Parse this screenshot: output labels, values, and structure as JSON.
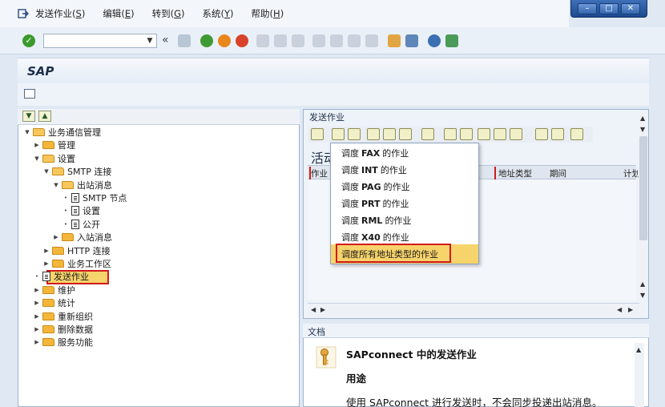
{
  "menu": {
    "items": [
      {
        "label": "发送作业",
        "key": "S"
      },
      {
        "label": "编辑",
        "key": "E"
      },
      {
        "label": "转到",
        "key": "G"
      },
      {
        "label": "系统",
        "key": "Y"
      },
      {
        "label": "帮助",
        "key": "H"
      }
    ]
  },
  "window_controls": {
    "minimize": "–",
    "maximize": "□",
    "close": "✕"
  },
  "toolbar": {
    "command_field_value": "",
    "nav_back": "«"
  },
  "title": "SAP",
  "tree": {
    "nodes": [
      {
        "label": "业务通信管理",
        "level": 0,
        "expanded": true,
        "type": "folder"
      },
      {
        "label": "管理",
        "level": 1,
        "expanded": false,
        "type": "folder"
      },
      {
        "label": "设置",
        "level": 1,
        "expanded": true,
        "type": "folder"
      },
      {
        "label": "SMTP 连接",
        "level": 2,
        "expanded": true,
        "type": "folder"
      },
      {
        "label": "出站消息",
        "level": 3,
        "expanded": true,
        "type": "folder"
      },
      {
        "label": "SMTP 节点",
        "level": 4,
        "type": "doc"
      },
      {
        "label": "设置",
        "level": 4,
        "type": "doc"
      },
      {
        "label": "公开",
        "level": 4,
        "type": "doc"
      },
      {
        "label": "入站消息",
        "level": 3,
        "expanded": false,
        "type": "folder"
      },
      {
        "label": "HTTP 连接",
        "level": 2,
        "expanded": false,
        "type": "folder"
      },
      {
        "label": "业务工作区",
        "level": 2,
        "expanded": false,
        "type": "folder"
      },
      {
        "label": "发送作业",
        "level": 1,
        "type": "doc",
        "selected": true
      },
      {
        "label": "维护",
        "level": 1,
        "expanded": false,
        "type": "folder"
      },
      {
        "label": "统计",
        "level": 1,
        "expanded": false,
        "type": "folder"
      },
      {
        "label": "重新组织",
        "level": 1,
        "expanded": false,
        "type": "folder"
      },
      {
        "label": "删除数据",
        "level": 1,
        "expanded": false,
        "type": "folder"
      },
      {
        "label": "服务功能",
        "level": 1,
        "expanded": false,
        "type": "folder"
      }
    ]
  },
  "right": {
    "header": "发送作业",
    "active_label": "活动",
    "columns": [
      "作业",
      "地址类型",
      "期间",
      "计划"
    ]
  },
  "dropdown": {
    "items": [
      {
        "pre": "调度",
        "code": "FAX",
        "post": "的作业"
      },
      {
        "pre": "调度",
        "code": "INT",
        "post": "的作业"
      },
      {
        "pre": "调度",
        "code": "PAG",
        "post": "的作业"
      },
      {
        "pre": "调度",
        "code": "PRT",
        "post": "的作业"
      },
      {
        "pre": "调度",
        "code": "RML",
        "post": "的作业"
      },
      {
        "pre": "调度",
        "code": "X40",
        "post": "的作业"
      }
    ],
    "highlighted": "调度所有地址类型的作业"
  },
  "doc": {
    "header": "文档",
    "title": "SAPconnect 中的发送作业",
    "subtitle": "用途",
    "text": "使用 SAPconnect 进行发送时，不会同步投递出站消息。"
  },
  "colors": {
    "highlight": "#f6d36b",
    "annotation": "#d11a1a",
    "folder": "#f4b63a"
  }
}
